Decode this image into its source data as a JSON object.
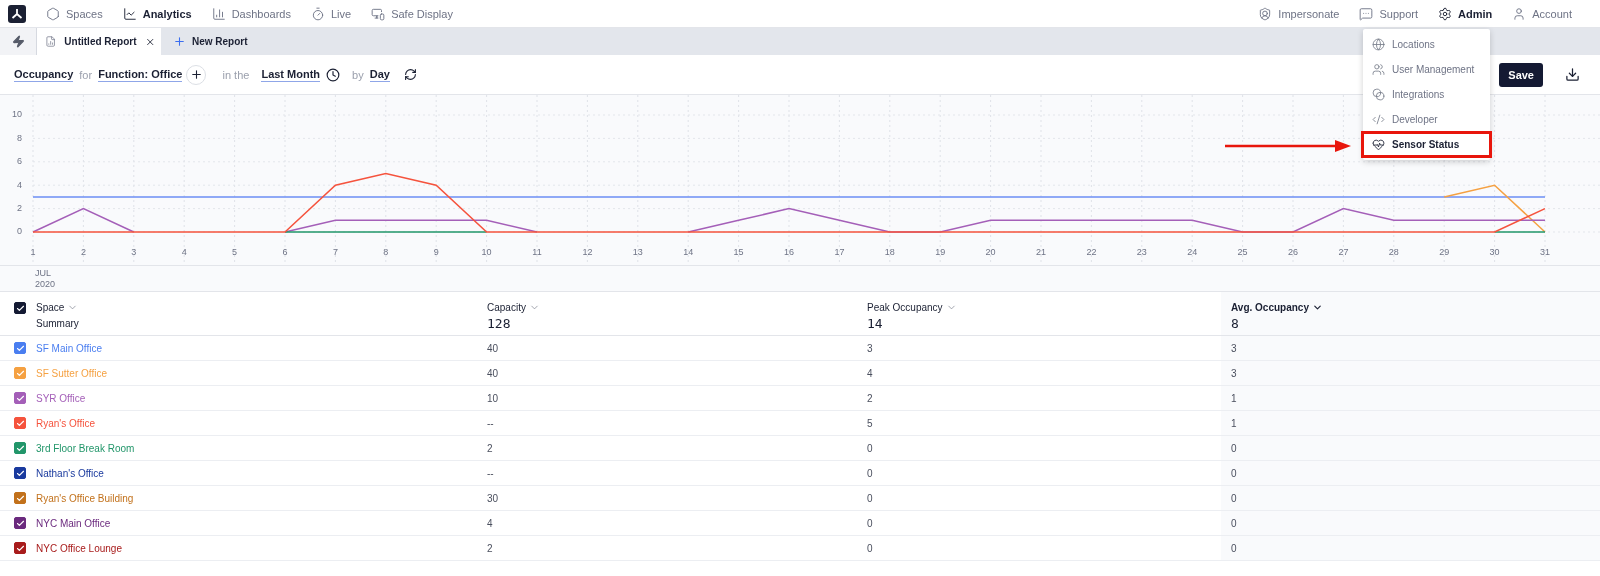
{
  "nav": {
    "left": [
      {
        "label": "Spaces",
        "selected": false
      },
      {
        "label": "Analytics",
        "selected": true
      },
      {
        "label": "Dashboards",
        "selected": false
      },
      {
        "label": "Live",
        "selected": false
      },
      {
        "label": "Safe Display",
        "selected": false
      }
    ],
    "right": [
      {
        "label": "Impersonate",
        "selected": false
      },
      {
        "label": "Support",
        "selected": false
      },
      {
        "label": "Admin",
        "selected": true
      },
      {
        "label": "Account",
        "selected": false
      }
    ]
  },
  "tabs": [
    {
      "label": "Untitled Report",
      "selected": true
    }
  ],
  "new_tab": "New Report",
  "query": {
    "metric": "Occupancy",
    "for": "for",
    "filter": "Function: Office",
    "in": "in the",
    "range": "Last Month",
    "by": "by",
    "interval": "Day"
  },
  "save": "Save",
  "admin_menu": [
    {
      "label": "Locations",
      "annotated": false
    },
    {
      "label": "User Management",
      "annotated": false
    },
    {
      "label": "Integrations",
      "annotated": false
    },
    {
      "label": "Developer",
      "annotated": false
    },
    {
      "label": "Sensor Status",
      "annotated": true
    }
  ],
  "chart": {
    "month": "JUL",
    "year": "2020",
    "chart_data": {
      "type": "line",
      "x": [
        1,
        2,
        3,
        4,
        5,
        6,
        7,
        8,
        9,
        10,
        11,
        12,
        13,
        14,
        15,
        16,
        17,
        18,
        19,
        20,
        21,
        22,
        23,
        24,
        25,
        26,
        27,
        28,
        29,
        30,
        31
      ],
      "xlim": [
        1,
        31
      ],
      "ylim": [
        0,
        10
      ],
      "yticks": [
        0,
        2,
        4,
        6,
        8,
        10
      ],
      "xticks": [
        1,
        2,
        3,
        4,
        5,
        6,
        7,
        8,
        9,
        10,
        11,
        12,
        13,
        14,
        15,
        16,
        17,
        18,
        19,
        20,
        21,
        22,
        23,
        24,
        25,
        26,
        27,
        28,
        29,
        30,
        31
      ],
      "grid": true,
      "series": [
        {
          "color": "#6b8ef5",
          "values": [
            3,
            3,
            3,
            3,
            3,
            3,
            3,
            3,
            3,
            3,
            3,
            3,
            3,
            3,
            3,
            3,
            3,
            3,
            3,
            3,
            3,
            3,
            3,
            3,
            3,
            3,
            3,
            3,
            3,
            3,
            3
          ]
        },
        {
          "color": "#f5a142",
          "values": [
            null,
            null,
            null,
            null,
            null,
            null,
            null,
            null,
            null,
            null,
            null,
            null,
            null,
            null,
            null,
            null,
            null,
            null,
            null,
            null,
            null,
            null,
            null,
            null,
            null,
            null,
            null,
            null,
            3,
            4,
            0
          ]
        },
        {
          "color": "#a45fb8",
          "values": [
            0,
            2,
            0,
            null,
            null,
            0,
            1,
            1,
            1,
            1,
            0,
            null,
            null,
            0,
            1,
            2,
            1,
            0,
            0,
            1,
            1,
            1,
            1,
            1,
            0,
            0,
            2,
            1,
            1,
            1,
            1
          ]
        },
        {
          "color": "#22966a",
          "values": [
            null,
            null,
            null,
            null,
            null,
            0,
            0,
            0,
            0,
            0,
            null,
            null,
            null,
            null,
            null,
            null,
            null,
            null,
            null,
            null,
            null,
            null,
            null,
            null,
            null,
            null,
            null,
            null,
            null,
            0,
            0
          ]
        },
        {
          "color": "#f5533d",
          "values": [
            0,
            0,
            0,
            0,
            0,
            0,
            4,
            5,
            4,
            0,
            0,
            0,
            0,
            0,
            0,
            0,
            0,
            0,
            0,
            0,
            0,
            0,
            0,
            0,
            0,
            0,
            0,
            0,
            0,
            0,
            2
          ]
        }
      ]
    }
  },
  "table": {
    "columns": [
      {
        "label": "Space",
        "summary": "Summary",
        "sorted": false
      },
      {
        "label": "Capacity",
        "summary": "128",
        "sorted": false
      },
      {
        "label": "Peak Occupancy",
        "summary": "14",
        "sorted": false
      },
      {
        "label": "Avg. Occupancy",
        "summary": "8",
        "sorted": true
      }
    ],
    "all_checked": true,
    "rows": [
      {
        "color": "#4a7ef0",
        "checked": true,
        "cells": [
          "SF Main Office",
          "40",
          "3",
          "3"
        ]
      },
      {
        "color": "#f5a142",
        "checked": true,
        "cells": [
          "SF Sutter Office",
          "40",
          "4",
          "3"
        ]
      },
      {
        "color": "#a45fb8",
        "checked": true,
        "cells": [
          "SYR Office",
          "10",
          "2",
          "1"
        ]
      },
      {
        "color": "#f5533d",
        "checked": true,
        "cells": [
          "Ryan's Office",
          "--",
          "5",
          "1"
        ]
      },
      {
        "color": "#22966a",
        "checked": true,
        "cells": [
          "3rd Floor Break Room",
          "2",
          "0",
          "0"
        ]
      },
      {
        "color": "#1a3a9e",
        "checked": true,
        "cells": [
          "Nathan's Office",
          "--",
          "0",
          "0"
        ]
      },
      {
        "color": "#c2711b",
        "checked": true,
        "cells": [
          "Ryan's Office Building",
          "30",
          "0",
          "0"
        ]
      },
      {
        "color": "#6b2a7e",
        "checked": true,
        "cells": [
          "NYC Main Office",
          "4",
          "0",
          "0"
        ]
      },
      {
        "color": "#a81c1c",
        "checked": true,
        "cells": [
          "NYC Office Lounge",
          "2",
          "0",
          "0"
        ]
      }
    ]
  }
}
